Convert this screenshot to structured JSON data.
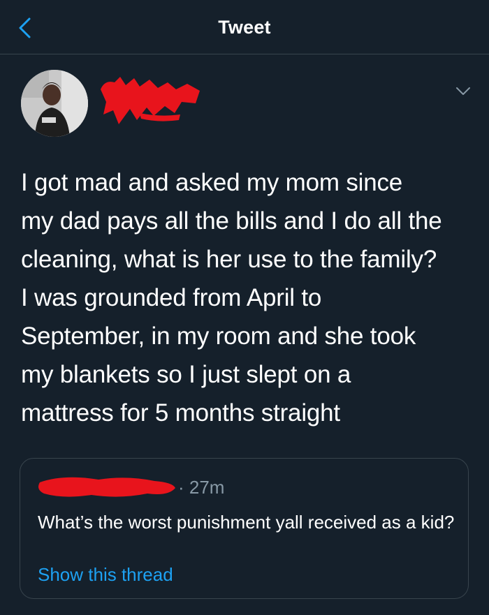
{
  "header": {
    "title": "Tweet",
    "back_icon": "chevron-left-icon"
  },
  "tweet": {
    "author_name": "",
    "menu_icon": "chevron-down-icon",
    "text": "I got mad and asked my mom since\nmy dad pays all the bills and I do all the\ncleaning, what is her use to the family?\nI was grounded from April to\nSeptember, in my room and she took\nmy blankets so I just slept on a\nmattress for 5 months straight"
  },
  "quoted_tweet": {
    "time": "· 27m",
    "text": "What’s the worst punishment yall received as a kid?",
    "show_thread": "Show this thread"
  },
  "colors": {
    "background": "#15202b",
    "accent": "#1da1f2",
    "border": "#38444d",
    "secondary_text": "#8899a6",
    "redaction": "#e8141c"
  }
}
